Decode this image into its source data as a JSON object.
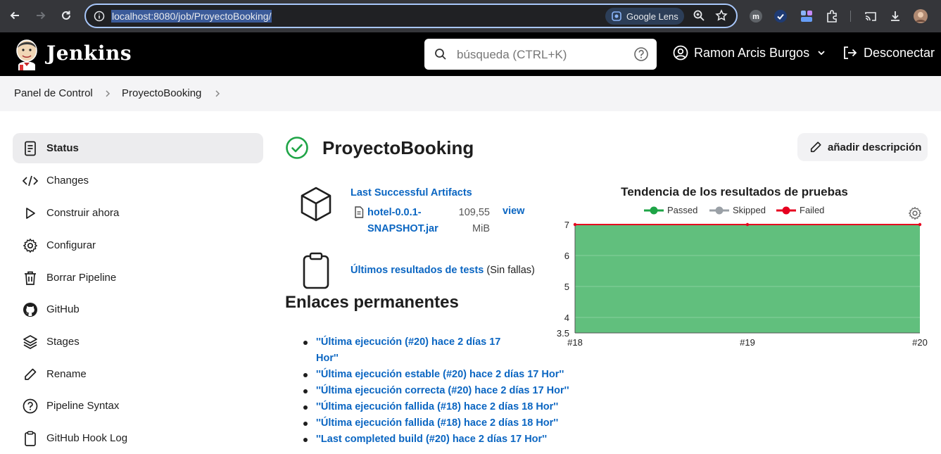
{
  "browser": {
    "url": "localhost:8080/job/ProyectoBooking/",
    "lens_label": "Google Lens"
  },
  "header": {
    "brand": "Jenkins",
    "search_placeholder": "búsqueda (CTRL+K)",
    "user_name": "Ramon Arcis Burgos",
    "logout_label": "Desconectar"
  },
  "breadcrumb": [
    "Panel de Control",
    "ProyectoBooking"
  ],
  "sidebar": {
    "items": [
      {
        "label": "Status",
        "icon": "document-icon"
      },
      {
        "label": "Changes",
        "icon": "code-icon"
      },
      {
        "label": "Construir ahora",
        "icon": "play-icon"
      },
      {
        "label": "Configurar",
        "icon": "gear-icon"
      },
      {
        "label": "Borrar Pipeline",
        "icon": "trash-icon"
      },
      {
        "label": "GitHub",
        "icon": "github-icon"
      },
      {
        "label": "Stages",
        "icon": "layers-icon"
      },
      {
        "label": "Rename",
        "icon": "pencil-icon"
      },
      {
        "label": "Pipeline Syntax",
        "icon": "help-circle-icon"
      },
      {
        "label": "GitHub Hook Log",
        "icon": "clipboard-icon"
      }
    ]
  },
  "main": {
    "title": "ProyectoBooking",
    "description_button": "añadir descripción",
    "artifacts": {
      "title": "Last Successful Artifacts",
      "file_name": "hotel-0.0.1-SNAPSHOT.jar",
      "file_size": "109,55 MiB",
      "view_label": "view"
    },
    "tests": {
      "link": "Últimos resultados de tests",
      "suffix": " (Sin fallas)"
    },
    "permalinks": {
      "title": "Enlaces permanentes",
      "items": [
        "''Última ejecución (#20) hace 2 días 17 Hor''",
        "''Última ejecución estable (#20) hace 2 días 17 Hor''",
        "''Última ejecución correcta (#20) hace 2 días 17 Hor''",
        "''Última ejecución fallida (#18) hace 2 días 18 Hor''",
        "''Última ejecución fallida (#18) hace 2 días 18 Hor''",
        "''Last completed build (#20) hace 2 días 17 Hor''"
      ]
    }
  },
  "colors": {
    "passed": "#1ea446",
    "skipped": "#9aa0a6",
    "failed": "#e6001f",
    "area": "#63c17a",
    "link": "#0b66c2"
  },
  "chart_data": {
    "type": "area",
    "title": "Tendencia de los resultados de pruebas",
    "legend": [
      {
        "name": "Passed",
        "color": "#1ea446"
      },
      {
        "name": "Skipped",
        "color": "#9aa0a6"
      },
      {
        "name": "Failed",
        "color": "#e6001f"
      }
    ],
    "legend_position": "top",
    "x": [
      "#18",
      "#19",
      "#20"
    ],
    "y_ticks": [
      "3.5",
      "4",
      "5",
      "6",
      "7"
    ],
    "ylim": [
      3.5,
      7
    ],
    "series": [
      {
        "name": "Passed",
        "values": [
          7,
          7,
          7
        ]
      },
      {
        "name": "Skipped",
        "values": [
          0,
          0,
          0
        ]
      },
      {
        "name": "Failed",
        "values": [
          0,
          0,
          0
        ]
      }
    ],
    "grid": true
  }
}
